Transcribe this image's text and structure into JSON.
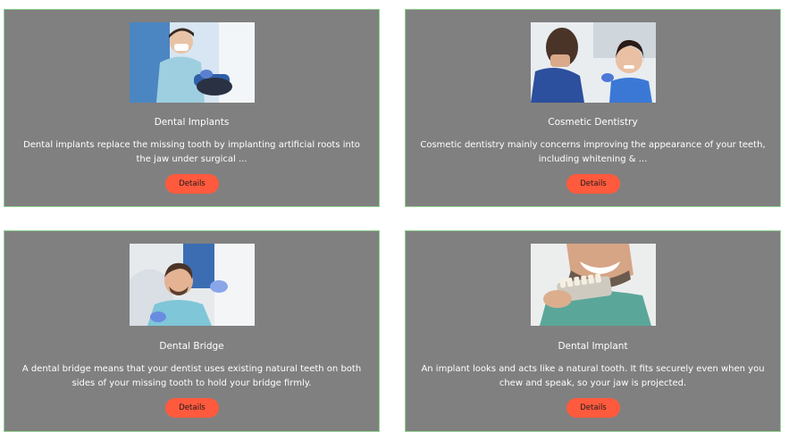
{
  "services": [
    {
      "image_icon": "dentist-treating-patient-photo",
      "title": "Dental Implants",
      "description": "Dental implants replace the missing tooth by implanting artificial roots into the jaw under surgical ...",
      "button_label": "Details"
    },
    {
      "image_icon": "smiling-patient-with-dentist-photo",
      "title": "Cosmetic Dentistry",
      "description": "Cosmetic dentistry mainly concerns improving the appearance of your teeth, including whitening & ...",
      "button_label": "Details"
    },
    {
      "image_icon": "patient-in-dental-chair-photo",
      "title": "Dental Bridge",
      "description": "A dental bridge means that your dentist uses existing natural teeth on both sides of your missing tooth to hold your bridge firmly.",
      "button_label": "Details"
    },
    {
      "image_icon": "tooth-shade-guide-photo",
      "title": "Dental Implant",
      "description": "An implant looks and acts like a natural tooth. It fits securely even when you chew and speak, so your jaw is projected.",
      "button_label": "Details"
    }
  ],
  "colors": {
    "card_background": "#808080",
    "card_border": "#8fd18f",
    "button_background": "#ff5a3d",
    "text": "#ffffff"
  }
}
